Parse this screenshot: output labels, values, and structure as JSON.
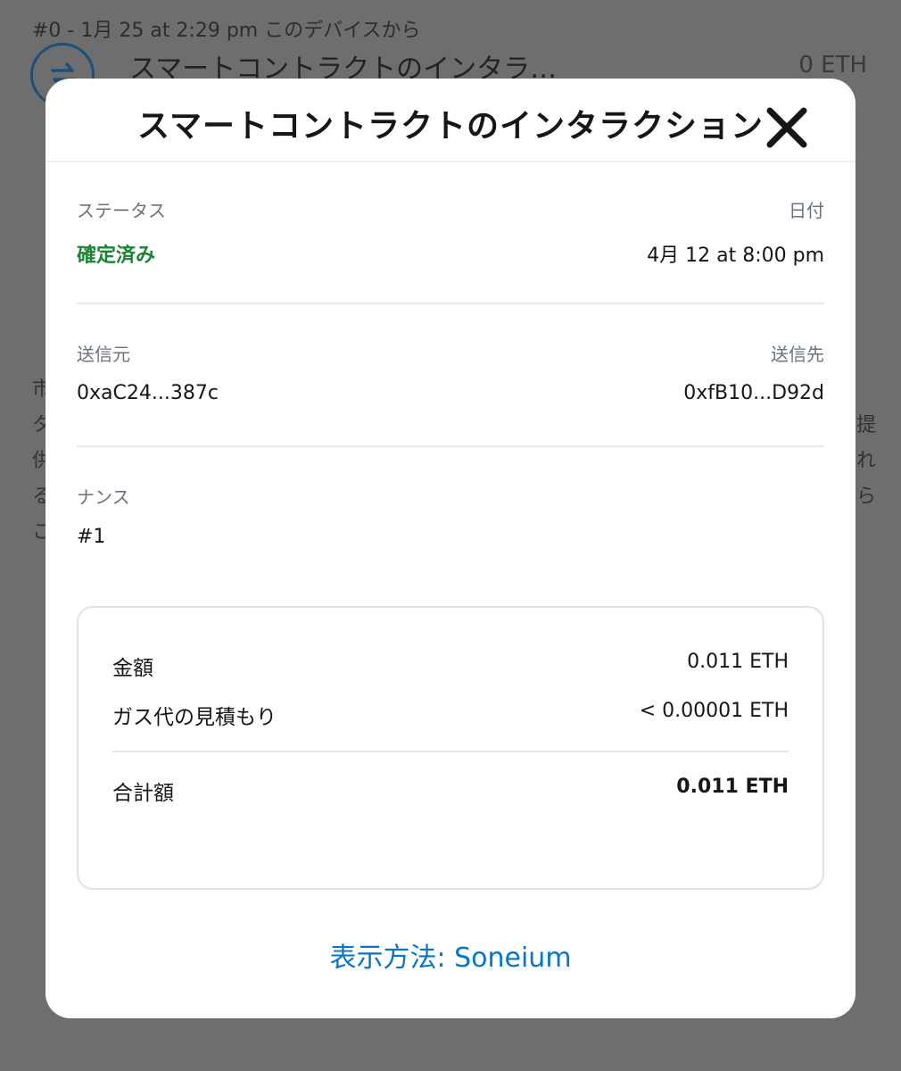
{
  "background": {
    "meta": "#0 - 1月 25 at 2:29 pm このデバイスから",
    "title": "スマートコントラクトのインタラ…",
    "amount": "0 ETH",
    "icon": "swap-arrows-icon",
    "fragments_left": [
      "市",
      "タ",
      "供",
      "る",
      "こ"
    ],
    "fragments_right": [
      "提",
      "れ",
      "ら"
    ]
  },
  "modal": {
    "title": "スマートコントラクトのインタラクション",
    "close_icon": "close-icon",
    "status": {
      "label": "ステータス",
      "value": "確定済み",
      "color": "#1c8234"
    },
    "date": {
      "label": "日付",
      "value": "4月 12 at 8:00 pm"
    },
    "from": {
      "label": "送信元",
      "value": "0xaC24...387c"
    },
    "to": {
      "label": "送信先",
      "value": "0xfB10...D92d"
    },
    "nonce": {
      "label": "ナンス",
      "value": "#1"
    },
    "summary": {
      "amount_label": "金額",
      "amount_value": "0.011 ETH",
      "gas_label": "ガス代の見積もり",
      "gas_value": "< 0.00001 ETH",
      "total_label": "合計額",
      "total_value": "0.011 ETH"
    },
    "explorer_link": "表示方法: Soneium",
    "link_color": "#0376c9"
  }
}
